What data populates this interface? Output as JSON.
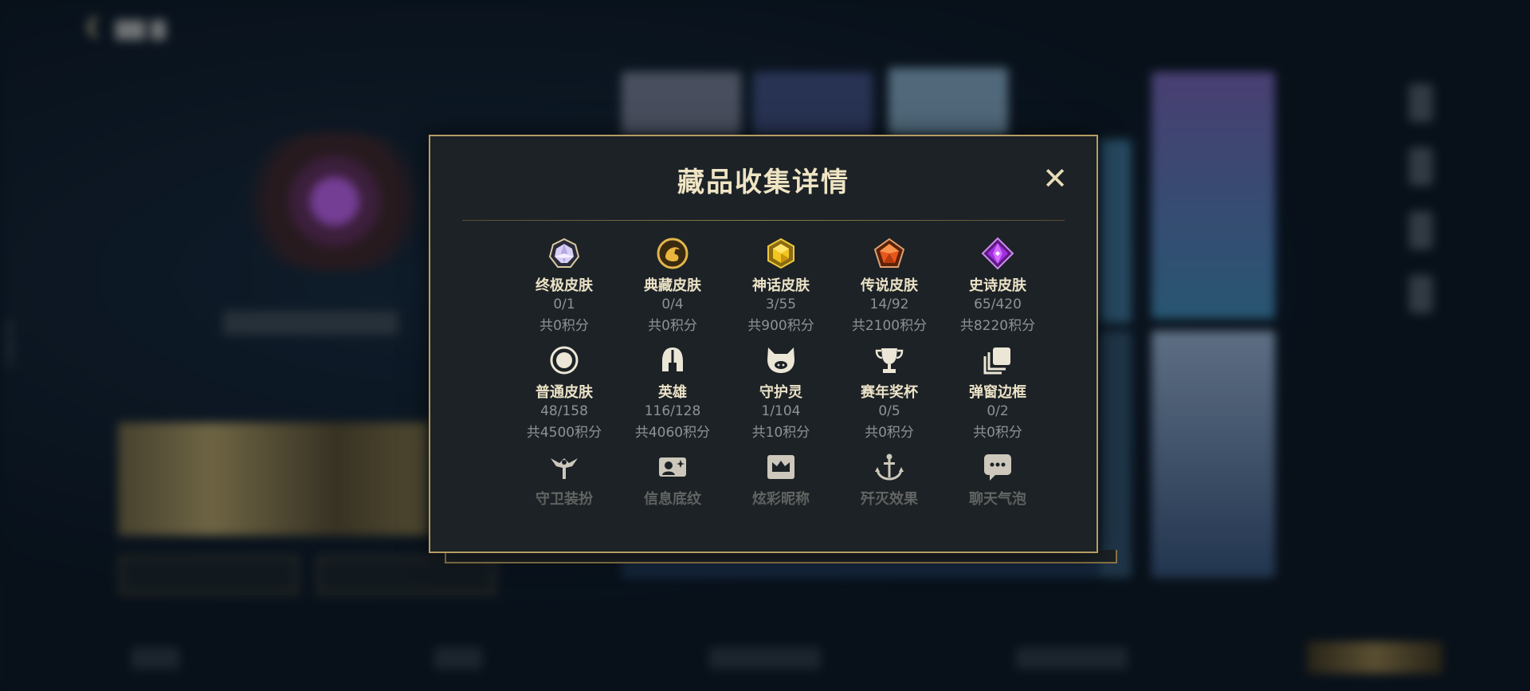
{
  "background": {
    "side_text": "13894781"
  },
  "dialog": {
    "title": "藏品收集详情",
    "close_glyph": "✕",
    "items": [
      {
        "name": "终极皮肤",
        "count": "0/1",
        "points": "共0积分",
        "icon": "ultimate-gem-icon"
      },
      {
        "name": "典藏皮肤",
        "count": "0/4",
        "points": "共0积分",
        "icon": "dragon-emblem-icon"
      },
      {
        "name": "神话皮肤",
        "count": "3/55",
        "points": "共900积分",
        "icon": "mythic-gem-icon"
      },
      {
        "name": "传说皮肤",
        "count": "14/92",
        "points": "共2100积分",
        "icon": "legendary-gem-icon"
      },
      {
        "name": "史诗皮肤",
        "count": "65/420",
        "points": "共8220积分",
        "icon": "epic-gem-icon"
      },
      {
        "name": "普通皮肤",
        "count": "48/158",
        "points": "共4500积分",
        "icon": "ring-icon"
      },
      {
        "name": "英雄",
        "count": "116/128",
        "points": "共4060积分",
        "icon": "helmet-icon"
      },
      {
        "name": "守护灵",
        "count": "1/104",
        "points": "共10积分",
        "icon": "little-legend-icon"
      },
      {
        "name": "赛年奖杯",
        "count": "0/5",
        "points": "共0积分",
        "icon": "trophy-icon"
      },
      {
        "name": "弹窗边框",
        "count": "0/2",
        "points": "共0积分",
        "icon": "frame-stack-icon"
      },
      {
        "name": "守卫装扮",
        "count": "",
        "points": "",
        "icon": "ward-icon"
      },
      {
        "name": "信息底纹",
        "count": "",
        "points": "",
        "icon": "profile-banner-icon"
      },
      {
        "name": "炫彩昵称",
        "count": "",
        "points": "",
        "icon": "crown-nameplate-icon"
      },
      {
        "name": "歼灭效果",
        "count": "",
        "points": "",
        "icon": "anchor-icon"
      },
      {
        "name": "聊天气泡",
        "count": "",
        "points": "",
        "icon": "chat-bubble-icon"
      }
    ]
  },
  "colors": {
    "accent_gold": "#b79d62",
    "dialog_bg": "#1c2226",
    "title": "#efe4c4",
    "muted": "#8f9295"
  }
}
